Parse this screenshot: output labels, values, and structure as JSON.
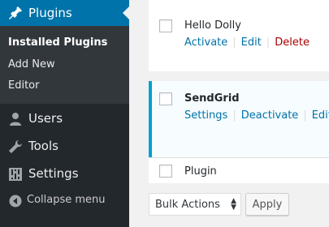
{
  "sidebar": {
    "plugins_label": "Plugins",
    "submenu": [
      "Installed Plugins",
      "Add New",
      "Editor"
    ],
    "users_label": "Users",
    "tools_label": "Tools",
    "settings_label": "Settings",
    "collapse_label": "Collapse menu"
  },
  "plugins": [
    {
      "name": "Hello Dolly",
      "actions": [
        "Activate",
        "Edit",
        "Delete"
      ]
    },
    {
      "name": "SendGrid",
      "actions": [
        "Settings",
        "Deactivate",
        "Edit"
      ]
    },
    {
      "name": "Plugin"
    }
  ],
  "bulk": {
    "selected": "Bulk Actions",
    "apply_label": "Apply"
  },
  "colors": {
    "accent": "#0073aa",
    "sidebar": "#23282d",
    "active_border": "#00a0d2",
    "delete": "#aa0000"
  }
}
